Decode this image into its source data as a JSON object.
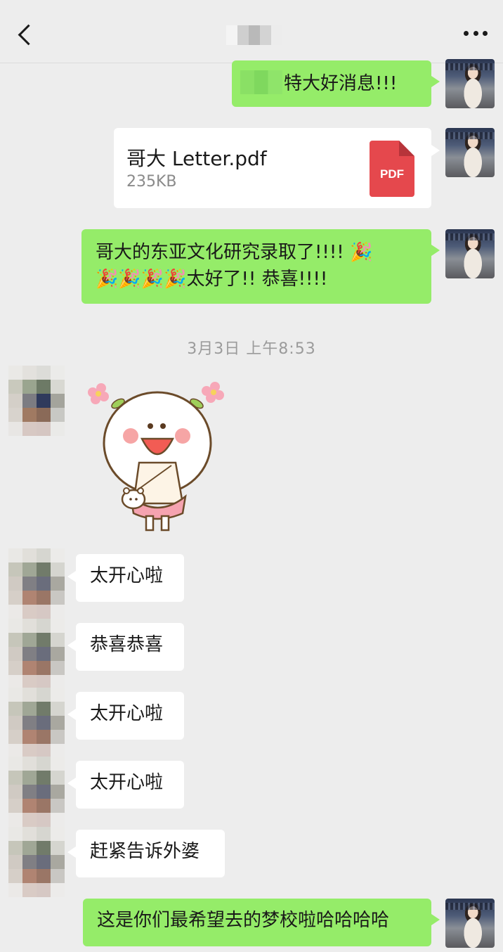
{
  "header": {
    "back_icon": "chevron-left-icon",
    "more_icon": "more-horizontal-icon",
    "title_redacted": true
  },
  "messages": {
    "m1": {
      "text": "特大好消息!!!"
    },
    "file": {
      "name": "哥大 Letter.pdf",
      "size": "235KB",
      "badge": "PDF"
    },
    "m3": {
      "line1": "哥大的东亚文化研究录取了!!!!",
      "emoji": "🎉",
      "line2": "太好了!! 恭喜!!!!"
    },
    "timestamp": "3月3日 上午8:53",
    "sticker_icon": "flower-girl-sticker",
    "r1": "太开心啦",
    "r2": "恭喜恭喜",
    "r3": "太开心啦",
    "r4": "太开心啦",
    "r5": "赶紧告诉外婆",
    "m_last": "这是你们最希望去的梦校啦哈哈哈哈"
  },
  "colors": {
    "sent_bubble": "#95ec69",
    "received_bubble": "#ffffff",
    "background": "#ededed",
    "pdf_red": "#e5484d"
  }
}
